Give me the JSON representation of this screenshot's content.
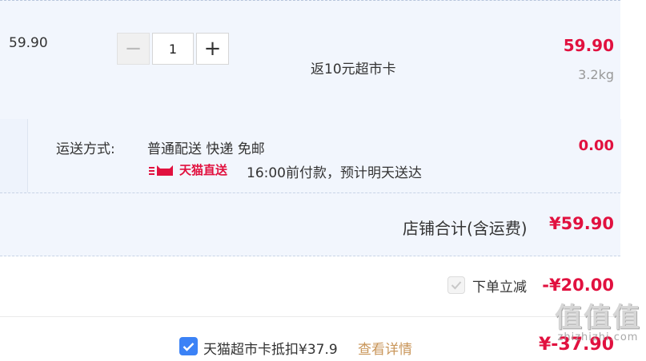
{
  "item": {
    "unit_price": "59.90",
    "quantity": "1",
    "minus_symbol": "−",
    "plus_symbol": "+",
    "promo": "返10元超市卡",
    "line_total": "59.90",
    "weight": "3.2kg"
  },
  "shipping": {
    "label": "运送方式:",
    "method": "普通配送 快递 免邮",
    "fee": "0.00",
    "tmall_direct": "天猫直送",
    "delivery_note": "16:00前付款，预计明天送达"
  },
  "store": {
    "total_label": "店铺合计(含运费)",
    "total_value": "¥59.90"
  },
  "discount": {
    "label": "下单立减",
    "amount": "-¥20.00",
    "checked": true
  },
  "supermarket_card": {
    "label": "天猫超市卡抵扣¥37.9",
    "details_link": "查看详情",
    "amount": "¥-37.90",
    "checked": true
  },
  "watermark": {
    "text": "值值值",
    "subtext": "zhizhizhi.com"
  },
  "colors": {
    "price_red": "#e1113f",
    "checkbox_blue": "#3b82f6",
    "link_tan": "#c9965a",
    "panel_bg": "#f2f6fd"
  }
}
